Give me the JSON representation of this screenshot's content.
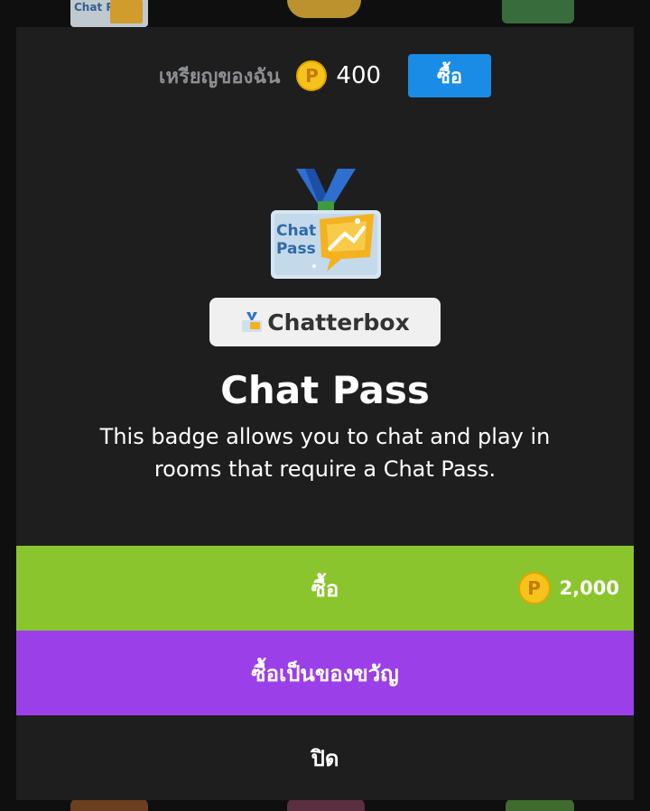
{
  "background_items": {
    "chat_pass_thumb_text": "Chat Pass"
  },
  "wallet": {
    "label": "เหรียญของฉัน",
    "balance": "400",
    "buy_label": "ซื้อ",
    "coin_symbol": "P"
  },
  "item": {
    "category": "Chatterbox",
    "title": "Chat Pass",
    "description": "This badge allows you to chat and play in rooms that require a Chat Pass.",
    "art_text_line1": "Chat",
    "art_text_line2": "Pass"
  },
  "actions": {
    "buy_label": "ซื้อ",
    "price": "2,000",
    "coin_symbol": "P",
    "gift_label": "ซื้อเป็นของขวัญ",
    "close_label": "ปิด"
  },
  "colors": {
    "buy_small": "#1a8ce6",
    "buy_button": "#8ac52d",
    "gift_button": "#9b3fe8",
    "modal_bg": "#1e1e1f",
    "coin": "#f6c21c"
  }
}
